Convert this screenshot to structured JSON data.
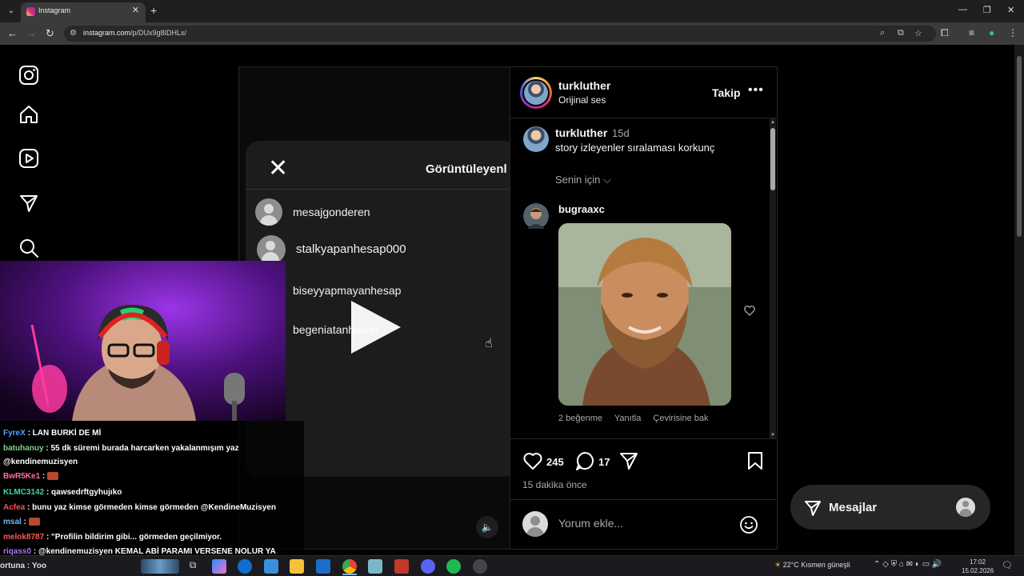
{
  "browser": {
    "tab_title": "Instagram",
    "url_host": "instagram.com",
    "url_path": "/p/DUx9g8IDHLx/"
  },
  "media": {
    "viewers_title": "Görüntüleyenl",
    "viewers": [
      "mesajgonderen",
      "stalkyapanhesap000",
      "biseyyapmayanhesap",
      "begeniatanhesap"
    ]
  },
  "post": {
    "username": "turkluther",
    "audio": "Orijinal ses",
    "follow_label": "Takip",
    "caption": {
      "username": "turkluther",
      "time": "15d",
      "text": "story izleyenler sıralaması korkunç"
    },
    "sort_label": "Senin için",
    "comment": {
      "username": "bugraaxc",
      "likes": "2 beğenme",
      "reply": "Yanıtla",
      "translate": "Çevirisine bak"
    },
    "like_count": "245",
    "comment_count": "17",
    "posted_time": "15 dakika önce",
    "comment_placeholder": "Yorum ekle..."
  },
  "messages": {
    "label": "Mesajlar"
  },
  "chat": [
    {
      "user": "FyreX",
      "text": ": LAN BURKİ DE Mİ",
      "color": "#4aa3ff"
    },
    {
      "user": "batuhanuy",
      "text": ": 55 dk süremi burada harcarken yakalanmışım yaz",
      "color": "#7bd389"
    },
    {
      "user": "",
      "text": "@kendinemuzisyen",
      "color": "#ffffff"
    },
    {
      "user": "BwR5Ke1",
      "text": ":",
      "color": "#ff6fa8"
    },
    {
      "user": "KLMC3142",
      "text": ": qawsedrftgyhujıko",
      "color": "#3fd6a7"
    },
    {
      "user": "Acfea",
      "text": ": bunu yaz kimse görmeden kimse görmeden @KendineMuzisyen",
      "color": "#ff4d4d"
    },
    {
      "user": "msal",
      "text": ":",
      "color": "#7bb6ff"
    },
    {
      "user": "melok8787",
      "text": ": \"Profilin bildirim gibi... görmeden geçilmiyor.",
      "color": "#ff5a5a"
    },
    {
      "user": "riqass0",
      "text": ": @kendinemuzisyen KEMAL ABİ PARAMI VERSENE NOLUR YA",
      "color": "#a77bff"
    }
  ],
  "taskbar": {
    "search_text": "ortuna : Yoo",
    "weather": "22°C  Kısmen güneşli",
    "time": "17:02",
    "date": "15.02.2026"
  },
  "colors": {
    "accent": "#0095f6",
    "background": "#000000",
    "border": "#262626",
    "muted": "#a8a8a8"
  }
}
